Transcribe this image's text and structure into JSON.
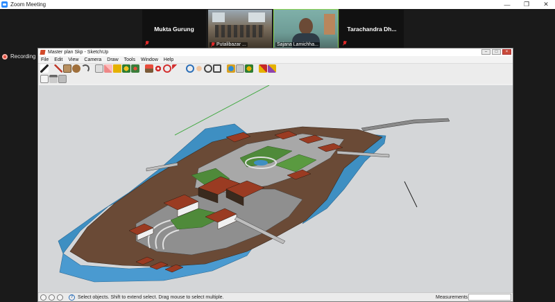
{
  "zoom": {
    "window_title": "Zoom Meeting",
    "minimize": "—",
    "maximize": "❐",
    "close": "✕",
    "recording_label": "Recording"
  },
  "participants": [
    {
      "name": "Mukta Gurung",
      "type": "name-only"
    },
    {
      "name": "Putalibazar ...",
      "type": "video-room"
    },
    {
      "name": "Sajana Lamichha...",
      "type": "video-face",
      "active_speaker": true
    },
    {
      "name": "Tarachandra  Dh...",
      "type": "name-only"
    }
  ],
  "sketchup": {
    "title": "Master plan Skp - SketchUp",
    "menus": [
      "File",
      "Edit",
      "View",
      "Camera",
      "Draw",
      "Tools",
      "Window",
      "Help"
    ],
    "status_text": "Select objects. Shift to extend select. Drag mouse to select multiple.",
    "measurements_label": "Measurements",
    "measurements_value": ""
  },
  "colors": {
    "viewport_bg": "#d4d6d8",
    "terrain": "#6a4a36",
    "water": "#3e8fc2",
    "lawn": "#4f8a3a",
    "roof": "#9a3b22",
    "paving": "#9a9a9a",
    "axis_green": "#44aa44",
    "active_speaker": "#8bd34f",
    "recording": "#e74c3c"
  }
}
